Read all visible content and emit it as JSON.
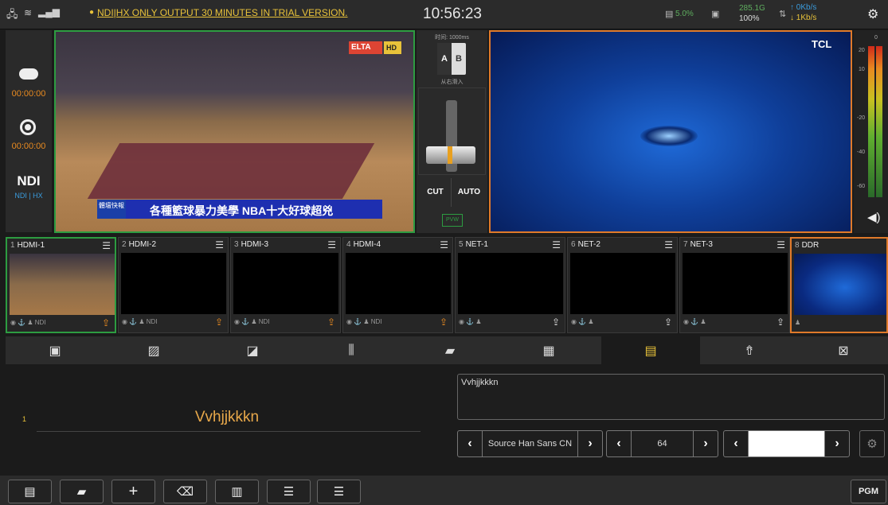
{
  "top": {
    "trial_notice": "NDI|HX ONLY OUTPUT 30 MINUTES IN TRIAL VERSION.",
    "clock": "10:56:23",
    "cpu": "5.0%",
    "storage_top": "285.1G",
    "storage_bottom": "100%",
    "net_up": "0Kb/s",
    "net_down": "1Kb/s"
  },
  "left": {
    "stream_time": "00:00:00",
    "record_time": "00:00:00",
    "ndi_logo": "NDI",
    "ndi_label": "NDI | HX"
  },
  "preview": {
    "logo_text": "ELTA",
    "hd": "HD",
    "banner_tag": "體壇快報",
    "caption": "各種籃球暴力美學 NBA十大好球超兇"
  },
  "transition": {
    "time": "时间: 1000ms",
    "a": "A",
    "b": "B",
    "direction": "从右滑入",
    "cut": "CUT",
    "auto": "AUTO"
  },
  "program": {
    "brand": "TCL"
  },
  "meter": {
    "scale": [
      "0",
      "20",
      "10",
      "-20",
      "-40",
      "-60"
    ]
  },
  "sources": [
    {
      "num": "1",
      "name": "HDMI-1",
      "tag": "NDI"
    },
    {
      "num": "2",
      "name": "HDMI-2",
      "tag": "NDI"
    },
    {
      "num": "3",
      "name": "HDMI-3",
      "tag": "NDI"
    },
    {
      "num": "4",
      "name": "HDMI-4",
      "tag": "NDI"
    },
    {
      "num": "5",
      "name": "NET-1",
      "tag": ""
    },
    {
      "num": "6",
      "name": "NET-2",
      "tag": ""
    },
    {
      "num": "7",
      "name": "NET-3",
      "tag": ""
    },
    {
      "num": "8",
      "name": "DDR",
      "tag": ""
    }
  ],
  "editor": {
    "line_num": "1",
    "title_text": "Vvhjjkkkn",
    "textbox": "Vvhjjkkkn",
    "font": "Source Han Sans CN",
    "size": "64"
  },
  "bottom": {
    "pgm": "PGM"
  },
  "colors": {
    "accent_orange": "#e07a2a",
    "preview_green": "#2d9c41",
    "notice_yellow": "#e8c23a"
  }
}
